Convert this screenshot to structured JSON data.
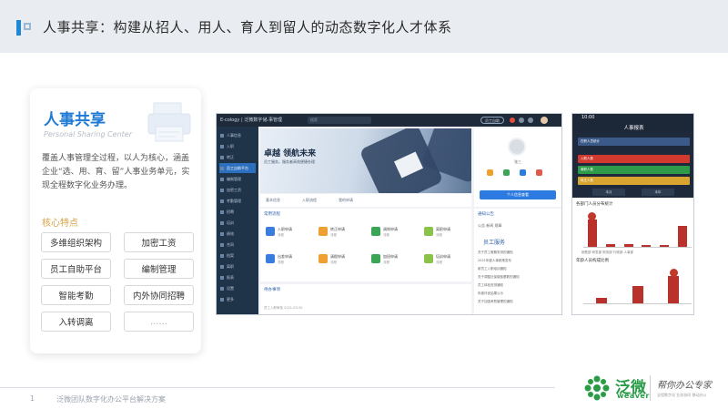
{
  "header": {
    "title": "人事共享：构建从招人、用人、育人到留人的动态数字化人才体系"
  },
  "card": {
    "title": "人事共享",
    "subtitle": "Personal Sharing Center",
    "description": "覆盖人事管理全过程，以人为核心，涵盖企业“选、用、育、留”人事业务单元，实现全程数字化业务办理。",
    "features_label": "核心特点",
    "features": [
      "多维组织架构",
      "加密工资",
      "员工自助平台",
      "编制管理",
      "智能考勤",
      "内外协同招聘",
      "入转调离",
      "……"
    ]
  },
  "desktop": {
    "logo": "E-cology | 泛微数字化",
    "nav": "人事管理",
    "search_placeholder": "搜索",
    "top_button": "员工自助",
    "sidebar": [
      "人事信息",
      "入职",
      "转正",
      "员工自助平台",
      "编制管理",
      "加密工资",
      "考勤管理",
      "招聘",
      "培训",
      "绩效",
      "合同",
      "档案",
      "离职",
      "报表",
      "设置",
      "更多"
    ],
    "banner_title": "卓越  领航未来",
    "banner_sub": "员工服务，服务者高效便捷办理",
    "tabs": [
      "基本信息",
      "入职流程",
      "我的申请"
    ],
    "profile_name": "张三",
    "profile_button": "个人信息查看",
    "panel_title": "常用流程",
    "tiles": [
      {
        "label": "入职申请",
        "sub": "流程"
      },
      {
        "label": "转正申请",
        "sub": "流程"
      },
      {
        "label": "调岗申请",
        "sub": "流程"
      },
      {
        "label": "离职申请",
        "sub": "流程"
      },
      {
        "label": "出差申请",
        "sub": "流程"
      },
      {
        "label": "请假申请",
        "sub": "流程"
      },
      {
        "label": "加班申请",
        "sub": "流程"
      },
      {
        "label": "培训申请",
        "sub": "流程"
      }
    ],
    "panel2_title": "待办事项",
    "panel2_line": "员工入职审批   2021-03-30",
    "notice_title": "通知公告",
    "notice_tabs": "公告  新闻  规章",
    "notice_big": "员工服务",
    "notices": [
      "关于员工假期安排的通知",
      "2021年度人事政策发布",
      "新员工入职培训通知",
      "关于调整社保缴费基数的通知",
      "员工体检安排通知",
      "年度评优结果公示",
      "关于加强考勤管理的通知"
    ]
  },
  "mobile": {
    "time": "10:00",
    "title": "人事报表",
    "bars": [
      "在职人员统计",
      "入职人数",
      "离职人数",
      "转正人数"
    ],
    "bar_colors": [
      "#3b5a8a",
      "#d23a2f",
      "#2f9b4a",
      "#d8a531"
    ],
    "buttons": [
      "本月",
      "本年"
    ],
    "section1": "各部门人员分布统计",
    "section2": "年龄人员构成比例",
    "chart1_values": [
      90,
      8,
      10,
      6,
      5,
      70
    ],
    "chart2_values": [
      20,
      60,
      95
    ],
    "chart_foot": "销售部  研发部  财务部  行政部  人事部"
  },
  "footer": {
    "page": "1",
    "text": "泛微团队数字化办公平台解决方案",
    "brand": "泛微",
    "brand_en": "weaver",
    "slogan": "帮你办公专家",
    "slogan_small": "全程数字化 业务协同 移动办公"
  }
}
